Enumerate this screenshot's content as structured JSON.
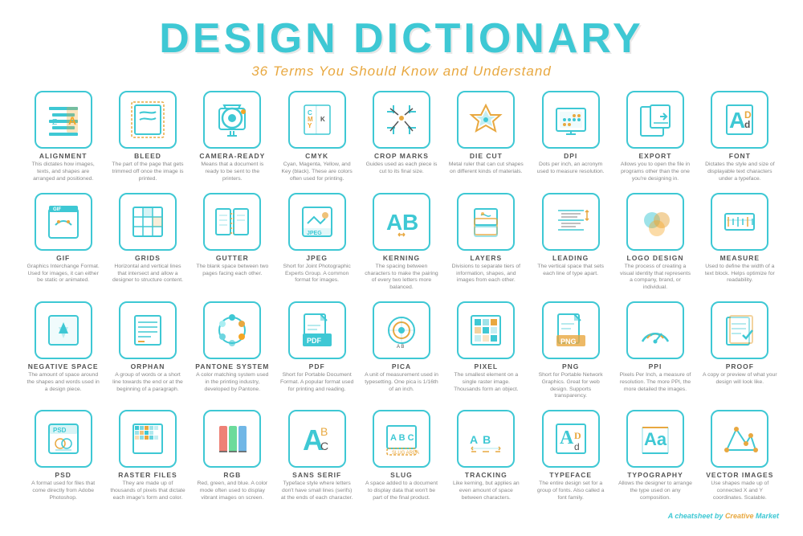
{
  "header": {
    "title": "DESIGN DICTIONARY",
    "subtitle": "36 Terms You Should Know and Understand"
  },
  "footer": {
    "text": "A cheatsheet by",
    "brand": "Creative Market"
  },
  "items": [
    {
      "id": "alignment",
      "title": "ALIGNMENT",
      "desc": "This dictates how images, texts, and shapes are arranged and positioned.",
      "icon": "alignment"
    },
    {
      "id": "bleed",
      "title": "BLEED",
      "desc": "The part of the page that gets trimmed off once the image is printed.",
      "icon": "bleed"
    },
    {
      "id": "camera-ready",
      "title": "CAMERA-READY",
      "desc": "Means that a document is ready to be sent to the printers.",
      "icon": "camera-ready"
    },
    {
      "id": "cmyk",
      "title": "CMYK",
      "desc": "Cyan, Magenta, Yellow, and Key (black). These are colors often used for printing.",
      "icon": "cmyk"
    },
    {
      "id": "crop-marks",
      "title": "CROP MARKS",
      "desc": "Guides used as each piece is cut to its final size.",
      "icon": "crop-marks"
    },
    {
      "id": "die-cut",
      "title": "DIE CUT",
      "desc": "Metal ruler that can cut shapes on different kinds of materials.",
      "icon": "die-cut"
    },
    {
      "id": "dpi",
      "title": "DPI",
      "desc": "Dots per inch, an acronym used to measure resolution.",
      "icon": "dpi"
    },
    {
      "id": "export",
      "title": "EXPORT",
      "desc": "Allows you to open the file in programs other than the one you're designing in.",
      "icon": "export"
    },
    {
      "id": "font",
      "title": "FONT",
      "desc": "Dictates the style and size of displayable text characters under a typeface.",
      "icon": "font"
    },
    {
      "id": "gif",
      "title": "GIF",
      "desc": "Graphics Interchange Format. Used for images, it can either be static or animated.",
      "icon": "gif"
    },
    {
      "id": "grids",
      "title": "GRIDS",
      "desc": "Horizontal and vertical lines that intersect and allow a designer to structure content.",
      "icon": "grids"
    },
    {
      "id": "gutter",
      "title": "GUTTER",
      "desc": "The blank space between two pages facing each other.",
      "icon": "gutter"
    },
    {
      "id": "jpeg",
      "title": "JPEG",
      "desc": "Short for Joint Photographic Experts Group. A common format for images.",
      "icon": "jpeg"
    },
    {
      "id": "kerning",
      "title": "KERNING",
      "desc": "The spacing between characters to make the pairing of every two letters more balanced.",
      "icon": "kerning"
    },
    {
      "id": "layers",
      "title": "LAYERS",
      "desc": "Divisions to separate tiers of information, shapes, and images from each other.",
      "icon": "layers"
    },
    {
      "id": "leading",
      "title": "LEADING",
      "desc": "The vertical space that sets each line of type apart.",
      "icon": "leading"
    },
    {
      "id": "logo-design",
      "title": "LOGO DESIGN",
      "desc": "The process of creating a visual identity that represents a company, brand, or individual.",
      "icon": "logo-design"
    },
    {
      "id": "measure",
      "title": "MEASURE",
      "desc": "Used to define the width of a text block. Helps optimize for readability.",
      "icon": "measure"
    },
    {
      "id": "negative-space",
      "title": "NEGATIVE SPACE",
      "desc": "The amount of space around the shapes and words used in a design piece.",
      "icon": "negative-space"
    },
    {
      "id": "orphan",
      "title": "ORPHAN",
      "desc": "A group of words or a short line towards the end or at the beginning of a paragraph.",
      "icon": "orphan"
    },
    {
      "id": "pantone-system",
      "title": "PANTONE SYSTEM",
      "desc": "A color matching system used in the printing industry, developed by Pantone.",
      "icon": "pantone-system"
    },
    {
      "id": "pdf",
      "title": "PDF",
      "desc": "Short for Portable Document Format. A popular format used for printing and reading.",
      "icon": "pdf"
    },
    {
      "id": "pica",
      "title": "PICA",
      "desc": "A unit of measurement used in typesetting. One pica is 1/16th of an inch.",
      "icon": "pica"
    },
    {
      "id": "pixel",
      "title": "PIXEL",
      "desc": "The smallest element on a single raster image. Thousands form an object.",
      "icon": "pixel"
    },
    {
      "id": "png",
      "title": "PNG",
      "desc": "Short for Portable Network Graphics. Great for web design. Supports transparency.",
      "icon": "png"
    },
    {
      "id": "ppi",
      "title": "PPI",
      "desc": "Pixels Per Inch, a measure of resolution. The more PPI, the more detailed the images.",
      "icon": "ppi"
    },
    {
      "id": "proof",
      "title": "PROOF",
      "desc": "A copy or preview of what your design will look like.",
      "icon": "proof"
    },
    {
      "id": "psd",
      "title": "PSD",
      "desc": "A format used for files that come directly from Adobe Photoshop.",
      "icon": "psd"
    },
    {
      "id": "raster-files",
      "title": "RASTER FILES",
      "desc": "They are made up of thousands of pixels that dictate each image's form and color.",
      "icon": "raster-files"
    },
    {
      "id": "rgb",
      "title": "RGB",
      "desc": "Red, green, and blue. A color mode often used to display vibrant images on screen.",
      "icon": "rgb"
    },
    {
      "id": "sans-serif",
      "title": "SANS SERIF",
      "desc": "Typeface style where letters don't have small lines (serifs) at the ends of each character.",
      "icon": "sans-serif"
    },
    {
      "id": "slug",
      "title": "SLUG",
      "desc": "A space added to a document to display data that won't be part of the final product.",
      "icon": "slug"
    },
    {
      "id": "tracking",
      "title": "TRACKING",
      "desc": "Like kerning, but applies an even amount of space between characters.",
      "icon": "tracking"
    },
    {
      "id": "typeface",
      "title": "TYPEFACE",
      "desc": "The entire design set for a group of fonts. Also called a font family.",
      "icon": "typeface"
    },
    {
      "id": "typography",
      "title": "TYPOGRAPHY",
      "desc": "Allows the designer to arrange the type used on any composition.",
      "icon": "typography"
    },
    {
      "id": "vector-images",
      "title": "VECTOR IMAGES",
      "desc": "Use shapes made up of connected X and Y coordinates. Scalable.",
      "icon": "vector-images"
    }
  ]
}
